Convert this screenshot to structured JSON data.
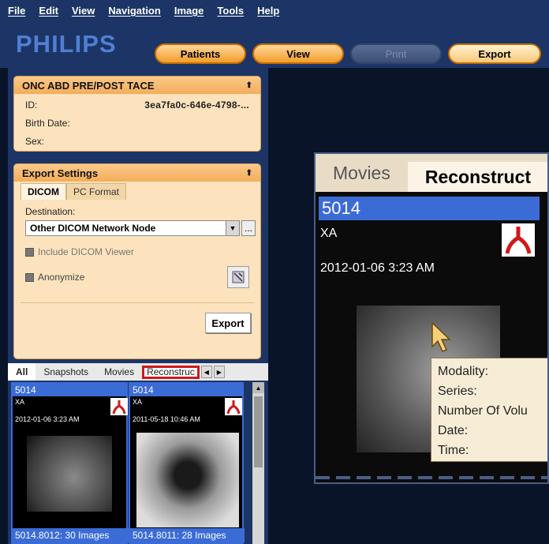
{
  "menu": [
    "File",
    "Edit",
    "View",
    "Navigation",
    "Image",
    "Tools",
    "Help"
  ],
  "logo": "PHILIPS",
  "nav_buttons": {
    "patients": "Patients",
    "view": "View",
    "print": "Print",
    "export": "Export"
  },
  "patient": {
    "title": "ONC ABD PRE/POST TACE",
    "id_label": "ID:",
    "id_value": "3ea7fa0c-646e-4798-...",
    "birth_label": "Birth Date:",
    "sex_label": "Sex:"
  },
  "export_settings": {
    "title": "Export Settings",
    "tabs": [
      "DICOM",
      "PC Format"
    ],
    "destination_label": "Destination:",
    "destination_value": "Other DICOM Network Node",
    "more_label": "...",
    "include_viewer": "Include DICOM Viewer",
    "anonymize": "Anonymize",
    "export_label": "Export"
  },
  "browse_tabs": [
    "All",
    "Snapshots",
    "Movies",
    "Reconstruc"
  ],
  "thumbnails": [
    {
      "id": "5014",
      "modality": "XA",
      "datetime": "2012-01-06 3:23 AM",
      "footer": "5014.8012: 30 Images"
    },
    {
      "id": "5014",
      "modality": "XA",
      "datetime": "2011-05-18 10:46 AM",
      "footer": "5014.8011: 28 Images"
    }
  ],
  "zoom": {
    "tabs": [
      "Movies",
      "Reconstruct"
    ],
    "header": "5014",
    "modality": "XA",
    "datetime": "2012-01-06 3:23 AM",
    "tooltip": [
      "Modality:",
      "Series:",
      "Number Of Volu",
      "Date:",
      "Time:"
    ]
  },
  "colors": {
    "accent_orange": "#f29d2a",
    "nav_blue": "#1c3566",
    "thumb_blue": "#3b6cd6",
    "highlight_red": "#d01919"
  }
}
